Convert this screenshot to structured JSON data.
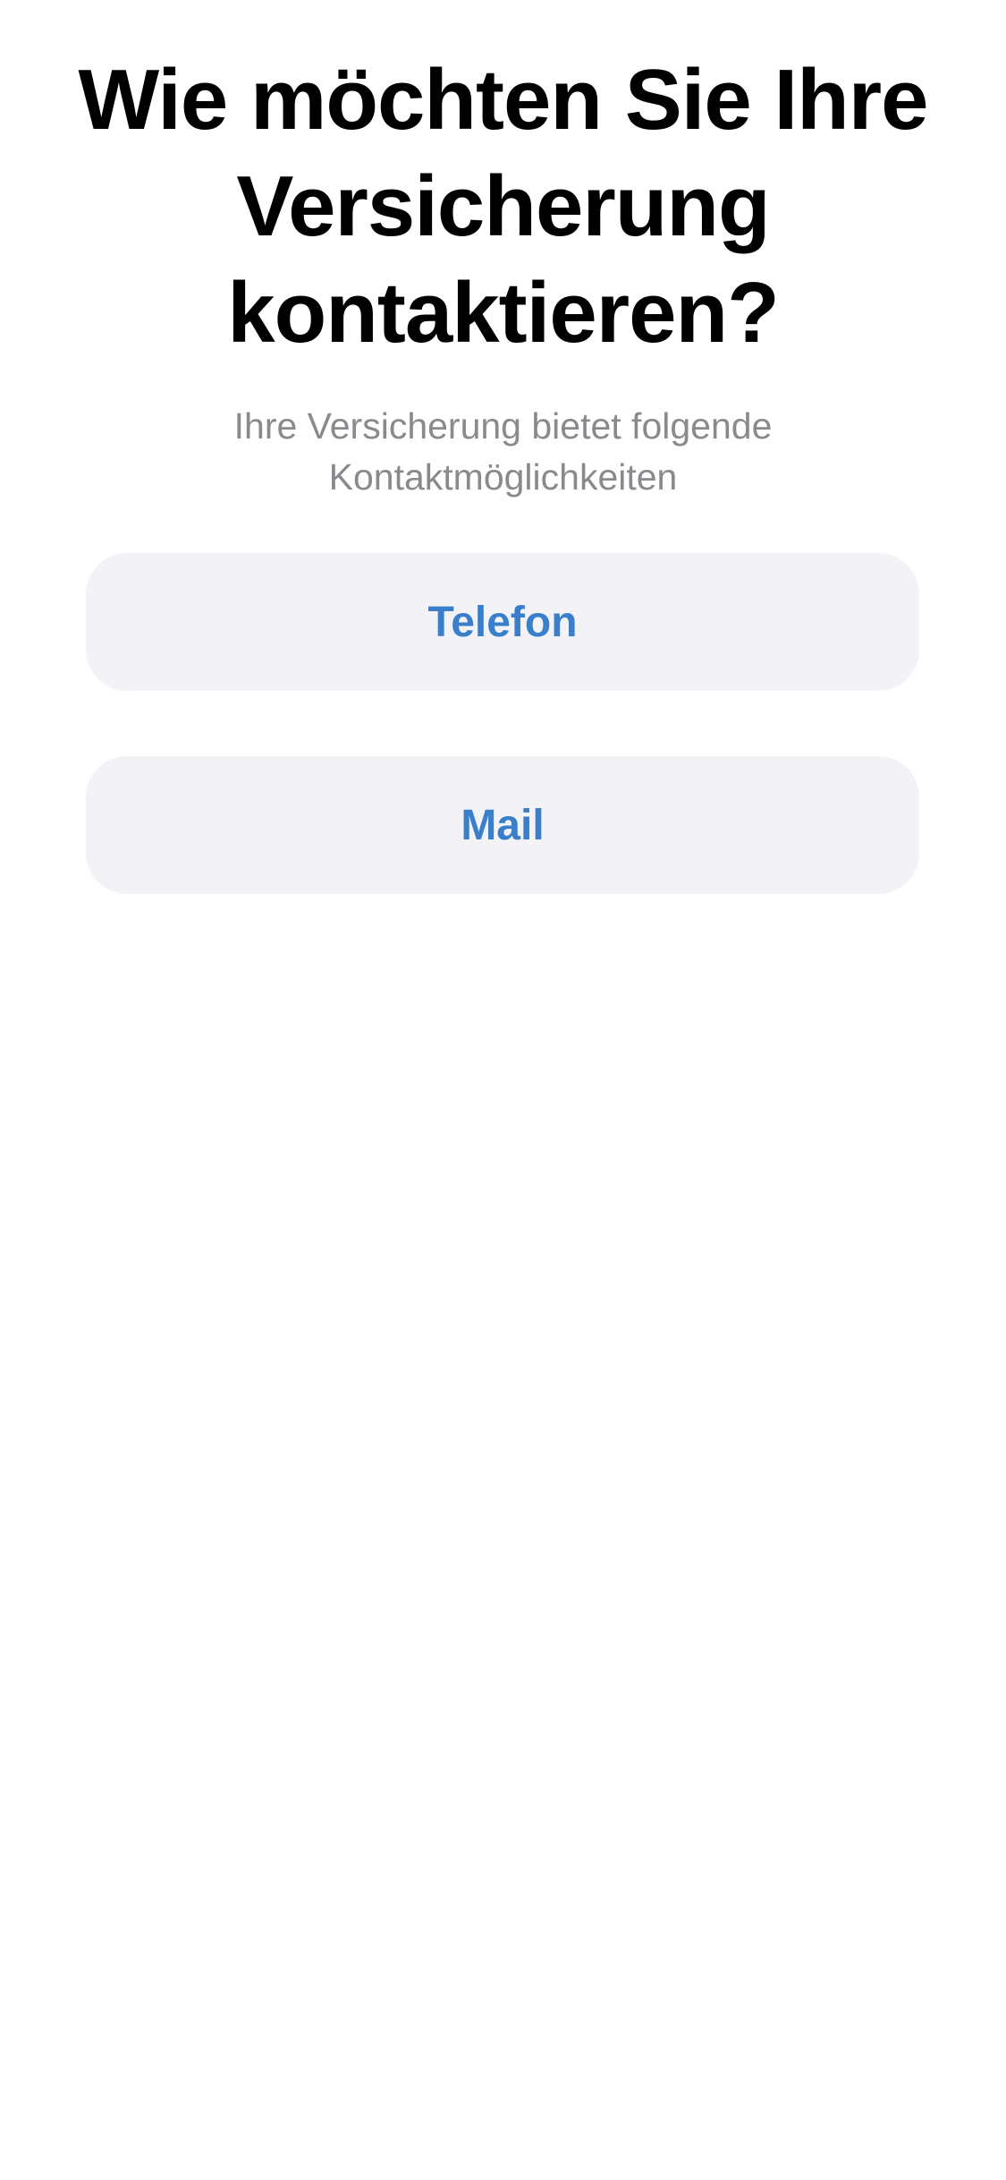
{
  "header": {
    "title": "Wie möchten Sie Ihre Versicherung kontaktieren?",
    "subtitle": "Ihre Versicherung bietet folgende Kontaktmöglichkeiten"
  },
  "options": [
    {
      "label": "Telefon"
    },
    {
      "label": "Mail"
    }
  ],
  "colors": {
    "background": "#ffffff",
    "title": "#000000",
    "subtitle": "#8a8a8e",
    "button_background": "#f2f2f7",
    "accent": "#3a7fcb"
  }
}
